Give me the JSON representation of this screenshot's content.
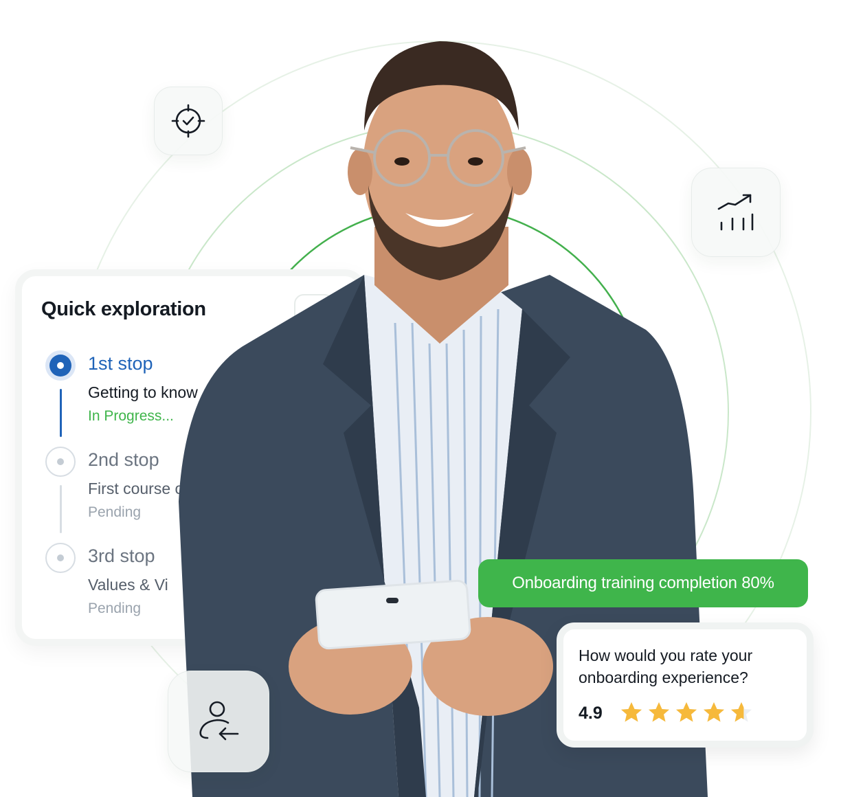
{
  "exploration_card": {
    "title": "Quick exploration",
    "menu_icon": "dots-icon",
    "steps": [
      {
        "name": "1st stop",
        "description": "Getting to know",
        "status": "In Progress...",
        "state": "active"
      },
      {
        "name": "2nd stop",
        "description": "First course o",
        "status": "Pending",
        "state": "pending"
      },
      {
        "name": "3rd stop",
        "description": "Values & Vi",
        "status": "Pending",
        "state": "pending"
      }
    ]
  },
  "tiles": {
    "target_icon": "target-check-icon",
    "growth_icon": "growth-chart-icon",
    "user_icon": "user-onboarding-icon"
  },
  "badge": {
    "text": "Onboarding training completion 80%"
  },
  "rating": {
    "question": "How would you rate your onboarding experience?",
    "score": "4.9",
    "stars_value": 4.9,
    "stars_max": 5
  },
  "colors": {
    "accent_green": "#3fb54b",
    "active_blue": "#1f63b8",
    "star_gold": "#f6b93b"
  }
}
